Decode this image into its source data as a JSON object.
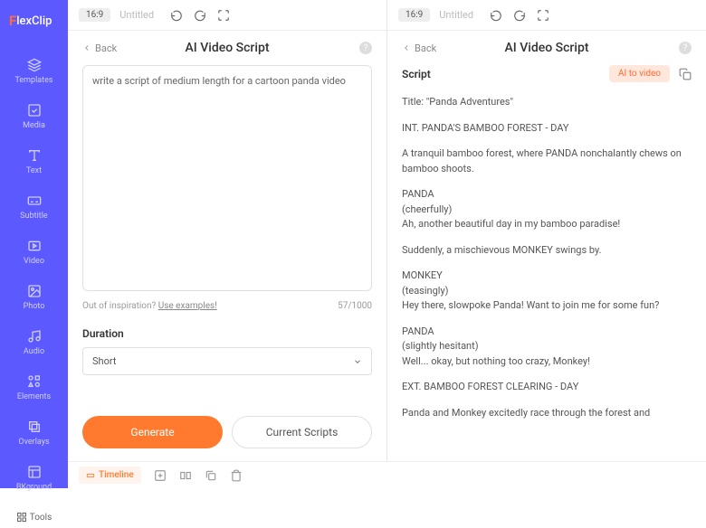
{
  "brand": "FlexClip",
  "sidebar": [
    "Templates",
    "Media",
    "Text",
    "Subtitle",
    "Video",
    "Photo",
    "Audio",
    "Elements",
    "Overlays",
    "BKground"
  ],
  "tools": "Tools",
  "topbar": {
    "ratio": "16:9",
    "name": "Untitled"
  },
  "left": {
    "back": "Back",
    "title": "AI Video Script",
    "prompt": "write a script of medium length for a cartoon panda video",
    "inspiration": "Out of inspiration? ",
    "examples": "Use examples!",
    "counter": "57/1000",
    "duration_label": "Duration",
    "duration_value": "Short",
    "generate": "Generate",
    "current": "Current Scripts"
  },
  "right": {
    "back": "Back",
    "title": "AI Video Script",
    "script_label": "Script",
    "ai_badge": "AI to video",
    "lines": [
      "Title: \"Panda Adventures\"",
      "INT. PANDA'S BAMBOO FOREST - DAY",
      "A tranquil bamboo forest, where PANDA nonchalantly chews on bamboo shoots.",
      "PANDA\n(cheerfully)\nAh, another beautiful day in my bamboo paradise!",
      "Suddenly, a mischievous MONKEY swings by.",
      "MONKEY\n(teasingly)\nHey there, slowpoke Panda! Want to join me for some fun?",
      "PANDA\n(slightly hesitant)\nWell... okay, but nothing too crazy, Monkey!",
      "EXT. BAMBOO FOREST CLEARING - DAY",
      "Panda and Monkey excitedly race through the forest and"
    ]
  },
  "timeline": "Timeline"
}
